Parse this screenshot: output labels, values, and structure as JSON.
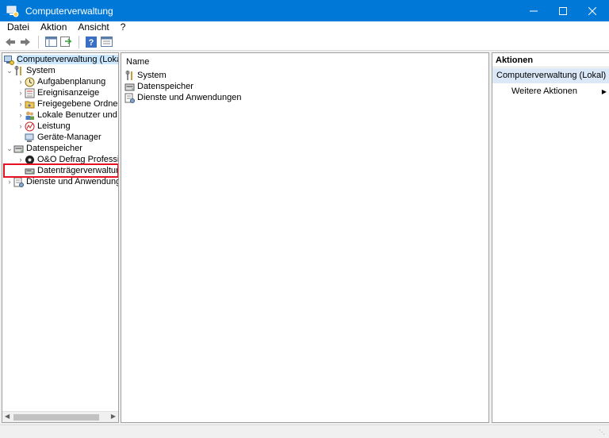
{
  "window": {
    "title": "Computerverwaltung"
  },
  "menu": [
    "Datei",
    "Aktion",
    "Ansicht",
    "?"
  ],
  "toolbar": {
    "buttons": [
      "back-icon",
      "forward-icon",
      "show-hide-console-tree-icon",
      "export-list-icon",
      "help-icon",
      "properties-icon"
    ]
  },
  "tree": {
    "root": "Computerverwaltung (Lokal)",
    "system": "System",
    "system_children": [
      "Aufgabenplanung",
      "Ereignisanzeige",
      "Freigegebene Ordner",
      "Lokale Benutzer und Gr",
      "Leistung",
      "Geräte-Manager"
    ],
    "storage": "Datenspeicher",
    "storage_children": [
      "O&O Defrag Profession",
      "Datenträgerverwaltung"
    ],
    "services": "Dienste und Anwendungen"
  },
  "list": {
    "column": "Name",
    "items": [
      "System",
      "Datenspeicher",
      "Dienste und Anwendungen"
    ]
  },
  "actions": {
    "header": "Aktionen",
    "section": "Computerverwaltung (Lokal)",
    "item": "Weitere Aktionen"
  },
  "colors": {
    "titlebar": "#0078d7",
    "highlight_box": "#e81123",
    "selection": "#cce8ff",
    "actions_section": "#dbe8f7"
  }
}
